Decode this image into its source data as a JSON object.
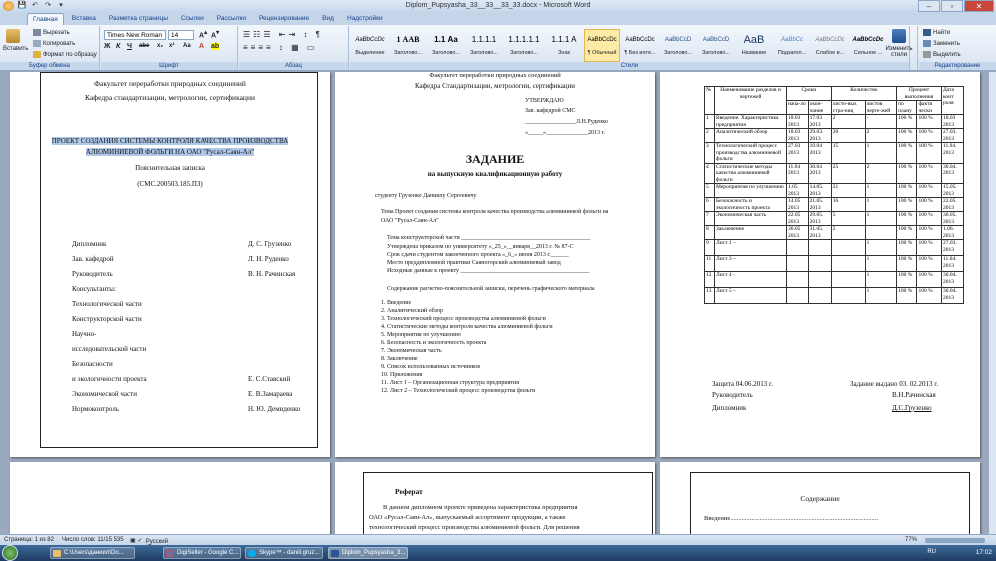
{
  "window": {
    "title": "Diplom_Pupsyasha_33__33__33_33.docx - Microsoft Word",
    "buttons": [
      "–",
      "▫",
      "✕"
    ]
  },
  "quick_access": [
    "💾",
    "↶",
    "↷",
    "▾"
  ],
  "tabs": [
    "Главная",
    "Вставка",
    "Разметка страницы",
    "Ссылки",
    "Рассылки",
    "Рецензирование",
    "Вид",
    "Надстройки"
  ],
  "ribbon": {
    "clipboard": {
      "paste": "Вставить",
      "cut": "Вырезать",
      "copy": "Копировать",
      "format": "Формат по образцу",
      "label": "Буфер обмена"
    },
    "font": {
      "name": "Times New Roman",
      "size": "14",
      "label": "Шрифт",
      "buttons": [
        "Ж",
        "К",
        "Ч",
        "abe",
        "x₂",
        "x²",
        "Aa",
        "A"
      ]
    },
    "paragraph": {
      "label": "Абзац"
    },
    "styles": {
      "label": "Стили",
      "items": [
        {
          "preview": "AaBbCcDc",
          "name": "Выделение"
        },
        {
          "preview": "1 ААВ",
          "name": "Заголово..."
        },
        {
          "preview": "1.1 Аа",
          "name": "Заголово..."
        },
        {
          "preview": "1.1.1.1",
          "name": "Заголово..."
        },
        {
          "preview": "1.1.1.1.1",
          "name": "Заголово..."
        },
        {
          "preview": "1.1.1 A",
          "name": "Знак"
        },
        {
          "preview": "AaBbCcDc",
          "name": "¶ Обычный"
        },
        {
          "preview": "AaBbCcDc",
          "name": "¶ Без инте..."
        },
        {
          "preview": "AaBbCcD",
          "name": "Заголово..."
        },
        {
          "preview": "AaBbCcD",
          "name": "Заголово..."
        },
        {
          "preview": "AaB",
          "name": "Название"
        },
        {
          "preview": "AaBbCc",
          "name": "Подзагол..."
        },
        {
          "preview": "AaBbCcDc",
          "name": "Слабое в..."
        },
        {
          "preview": "AaBbCcDc",
          "name": "Сильное ..."
        }
      ],
      "change": "Изменить стили"
    },
    "editing": {
      "find": "Найти",
      "replace": "Заменить",
      "select": "Выделить",
      "label": "Редактирование"
    }
  },
  "page1": {
    "faculty": "Факультет переработки природных соединений",
    "dept": "Кафедра стандартизации, метрологии, сертификации",
    "project": [
      "ПРОЕКТ СОЗДАНИЯ СИСТЕМЫ КОНТРОЛЯ КАЧЕСТВА ПРОИЗВОДСТВА",
      "АЛЮМИНИЕВОЙ ФОЛЬГИ НА ОАО \"Русал-Саян-Ал\""
    ],
    "note": "Пояснительная записка",
    "code": "(СМС.200503.185.ПЗ)",
    "rows": [
      {
        "l": "Дипломник",
        "r": "Д. С. Грузенко"
      },
      {
        "l": "Зав. кафедрой",
        "r": "Л. Н. Руденко"
      },
      {
        "l": "Руководитель",
        "r": "В. Н. Рачинская"
      },
      {
        "l": "Консультанты:",
        "r": ""
      },
      {
        "l": "Технологической части",
        "r": ""
      },
      {
        "l": "Конструкторской части",
        "r": ""
      },
      {
        "l": "Научно-",
        "r": ""
      },
      {
        "l": "исследовательской части",
        "r": ""
      },
      {
        "l": "Безопасности",
        "r": ""
      },
      {
        "l": "и экологичности проекта",
        "r": "Е. С.Ставский"
      },
      {
        "l": "Экономической части",
        "r": "Е. В.Замарaева"
      },
      {
        "l": "Нормоконтроль",
        "r": "Н. Ю. Демиденко"
      }
    ]
  },
  "page2": {
    "top": "Факультет    переработки природных соединений",
    "dept": "Кафедра Стандартизации, метрологии, сертификации",
    "approve": [
      "УТВЕРЖДАЮ",
      "Зав. кафедрой СМС",
      "_________________Л.Н.Руденко",
      "«_____»______________2013  г."
    ],
    "title": "ЗАДАНИЕ",
    "subtitle": "на выпускную квалификационную работу",
    "student": "студенту            Грузенко Даниилу Сергеевичу",
    "topic": [
      "Тема Проект  создания системы контроля качества производства алюминиевой фольги  на",
      "ОАО \"Русал-Саян-Ал\""
    ],
    "lines": [
      "Тема конструкторской   части  ___________________________________________",
      "Утверждена приказом по университету  «_25_»__января__2013  г. № 87-С",
      "Срок сдачи студентом законченного проекта «_6_» июня 2013 г.______",
      "Место преддипломной практики  Саяногорский алюминиевый завод",
      "Исходные данные к проекту ___________________________________________"
    ],
    "content_title": "Содержание расчетно-пояснительной записки, перечень графического материала",
    "list": [
      "1.  Введение",
      "2.  Аналитический обзор",
      "3.  Технологический процесс производства алюминиевой фольги",
      "4.  Статистические методы контроля качества алюминиевой фольги",
      "5.  Мероприятия по улучшению",
      "6.  Безопасность и экологичность проекта",
      "7.  Экономическая часть",
      "8.  Заключение",
      "9.  Список использованных источников",
      "10. Приложения",
      "11. Лист 1 – Организационная  структура предприятия",
      "12. Лист 2 – Технологический процесс производства фольги"
    ]
  },
  "page3": {
    "headers": [
      "№",
      "Наименование разделов и чертежей",
      "Сроки",
      "Количество",
      "Процент выполнения",
      "Дата конт роля"
    ],
    "subheaders": [
      "нача-ло",
      "окон-чание",
      "листо-вых стра-ниц",
      "листов черте-жей",
      "по плану",
      "факти чески"
    ],
    "rows": [
      {
        "n": "1",
        "name": "Введение. Характеристика предприятия",
        "s": "18.03 2013",
        "e": "17.03 2013",
        "p": "2",
        "d": "-",
        "plan": "100 %",
        "fact": "100 %",
        "date": "18.03 2013"
      },
      {
        "n": "2",
        "name": "Аналитический обзор",
        "s": "18.03 2013",
        "e": "29.03. 2013",
        "p": "20",
        "d": "2",
        "plan": "100 %",
        "fact": "100 %",
        "date": "27.03. 2013"
      },
      {
        "n": "3",
        "name": "Технологический процесс производства алюминиевой фольги",
        "s": "27.03 2013",
        "e": "10.04 2013",
        "p": "15",
        "d": "1",
        "plan": "100 %",
        "fact": "100 %",
        "date": "11.04. 2013"
      },
      {
        "n": "4",
        "name": "Статистические методы качества алюминиевой фольги",
        "s": "11.04 2013",
        "e": "30.04 2013",
        "p": "25",
        "d": "2",
        "plan": "100 %",
        "fact": "100 %",
        "date": "30.04. 2013"
      },
      {
        "n": "5",
        "name": "Мероприятия по улучшению",
        "s": "1.05 2013",
        "e": "14.05. 2013",
        "p": "21",
        "d": "1",
        "plan": "100 %",
        "fact": "100 %",
        "date": "15.05. 2013"
      },
      {
        "n": "6",
        "name": "Безопасность и экологичность проекта",
        "s": "14.05 2013",
        "e": "21.05. 2013",
        "p": "16",
        "d": "1",
        "plan": "100 %",
        "fact": "100 %",
        "date": "22.05. 2013"
      },
      {
        "n": "7",
        "name": "Экономическая часть",
        "s": "22.05 2013",
        "e": "29.05. 2013",
        "p": "5",
        "d": "1",
        "plan": "100 %",
        "fact": "100 %",
        "date": "30.05. 2013"
      },
      {
        "n": "8",
        "name": "Заключение",
        "s": "30.05 2013",
        "e": "31.05. 2013",
        "p": "2",
        "d": "",
        "plan": "100 %",
        "fact": "100 %",
        "date": "1.06. 2013"
      },
      {
        "n": "9",
        "name": "Лист 1 –",
        "s": "",
        "e": "",
        "p": "",
        "d": "1",
        "plan": "100 %",
        "fact": "100 %",
        "date": "27.03. 2013"
      },
      {
        "n": "11",
        "name": "Лист 3 –",
        "s": "",
        "e": "",
        "p": "",
        "d": "1",
        "plan": "100 %",
        "fact": "100 %",
        "date": "11.04. 2013"
      },
      {
        "n": "12",
        "name": "Лист 4 -",
        "s": "",
        "e": "",
        "p": "",
        "d": "1",
        "plan": "100 %",
        "fact": "100 %",
        "date": "30.04. 2013"
      },
      {
        "n": "13",
        "name": "Лист 5 –",
        "s": "",
        "e": "",
        "p": "",
        "d": "1",
        "plan": "100 %",
        "fact": "100 %",
        "date": "30.04. 2013"
      }
    ],
    "footer": [
      {
        "l": "Защита          04.06.2013  г.",
        "r": "Задание выдано 03. 02.2013  г."
      },
      {
        "l": "Руководитель",
        "r": "В.Н.Рачинская"
      },
      {
        "l": "Дипломник",
        "r": "Д.С.Грузенко"
      }
    ]
  },
  "page4": {
    "title": "Реферат",
    "text": [
      "В  данном  дипломном  проекте  приведена  характеристика  предприятия",
      "ОАО  «Русал-Саян-Ал»,  выпускаемый  ассортимент  продукции,  а  также",
      "технологический процесс производства алюминиевой фольги.  Для решения"
    ]
  },
  "page5": {
    "title": "Содержание",
    "intro": "Введение..........................................................................................."
  },
  "status": {
    "page": "Страница: 1 из 82",
    "words": "Число слов: 11/15 535",
    "lang": "Русский (Россия)",
    "zoom": "77%"
  },
  "taskbar": {
    "items": [
      "C:\\Users\\даниил\\Do...",
      "DigiSeller - Google C...",
      "Skype™ - daniil.gruz...",
      "Diplom_Pupsyasha_3..."
    ],
    "lang": "RU",
    "time": "17:02"
  }
}
